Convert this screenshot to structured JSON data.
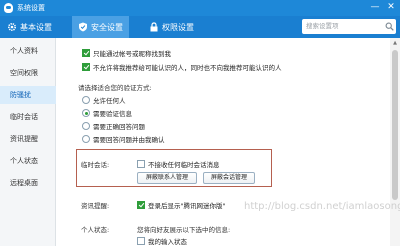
{
  "window": {
    "title": "系统设置",
    "minimize": "—",
    "close": "✕"
  },
  "toolbar": {
    "tabs": [
      {
        "label": "基本设置",
        "icon": "gear-icon"
      },
      {
        "label": "安全设置",
        "icon": "shield-icon"
      },
      {
        "label": "权限设置",
        "icon": "lock-icon"
      }
    ],
    "search_placeholder": "搜索设置项"
  },
  "sidebar": {
    "items": [
      {
        "label": "个人资料"
      },
      {
        "label": "空间权限"
      },
      {
        "label": "防骚扰"
      },
      {
        "label": "临时会话"
      },
      {
        "label": "资讯提醒"
      },
      {
        "label": "个人状态"
      },
      {
        "label": "远程桌面"
      }
    ]
  },
  "content": {
    "opt_find_by_account": "只能通过帐号或昵称找到我",
    "opt_no_recommend": "不允许将我推荐给可能认识的人，同时也不向我推荐可能认识的人",
    "verify_prompt": "请选择适合您的验证方式:",
    "verify_options": [
      {
        "label": "允许任何人"
      },
      {
        "label": "需要验证信息"
      },
      {
        "label": "需要正确回答问题"
      },
      {
        "label": "需要回答问题并由我确认"
      }
    ],
    "temp_session": {
      "label": "临时会话:",
      "checkbox_label": "不接收任何临时会话消息",
      "btn_contacts": "屏蔽联系人管理",
      "btn_sessions": "屏蔽会话管理"
    },
    "news": {
      "label": "资讯提醒:",
      "checkbox_label": "登录后显示\"腾讯网迷你版\""
    },
    "personal_status": {
      "label": "个人状态:",
      "description": "您将向好友展示以下选中的信息:",
      "checkbox_label": "我的输入状态"
    }
  },
  "watermark": "http://blog.csdn.net/iamlaosong",
  "colors": {
    "titlebar": "#1e88d8",
    "toolbar": "#1a7fd1",
    "accent_green": "#2e9d3a",
    "highlight_box": "#b5604f"
  }
}
